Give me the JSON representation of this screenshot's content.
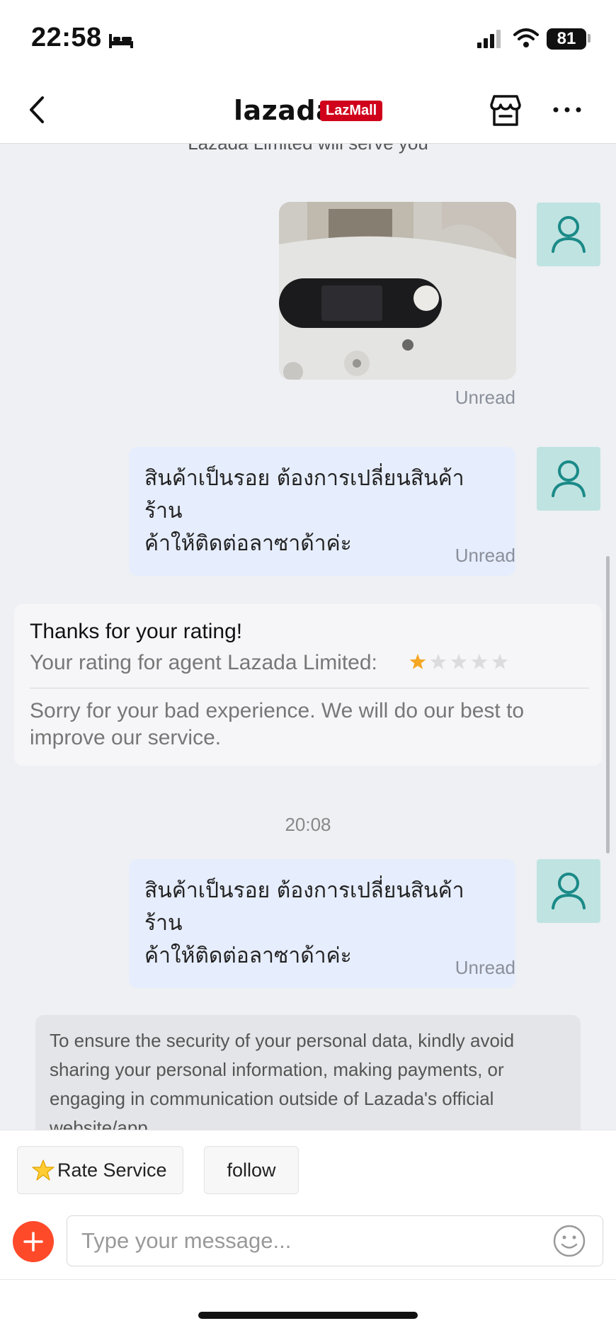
{
  "status_bar": {
    "time": "22:58",
    "battery": "81"
  },
  "header": {
    "brand": "lazada",
    "badge": "LazMall"
  },
  "chat": {
    "cut_note": "Lazada Limited will serve you",
    "messages": [
      {
        "type": "image",
        "status": "Unread"
      },
      {
        "type": "text",
        "text": "สินค้าเป็นรอย ต้องการเปลี่ยนสินค้า ร้านค้าให้ติดต่อลาซาด้าค่ะ",
        "line1": "สินค้าเป็นรอย ต้องการเปลี่ยนสินค้า ร้าน",
        "line2": "ค้าให้ติดต่อลาซาด้าค่ะ",
        "status": "Unread"
      },
      {
        "type": "text",
        "text": "สินค้าเป็นรอย ต้องการเปลี่ยนสินค้า ร้านค้าให้ติดต่อลาซาด้าค่ะ",
        "line1": "สินค้าเป็นรอย ต้องการเปลี่ยนสินค้า ร้าน",
        "line2": "ค้าให้ติดต่อลาซาด้าค่ะ",
        "status": "Unread"
      }
    ],
    "rating_card": {
      "title": "Thanks for your rating!",
      "agent_line": "Your rating for agent Lazada Limited:",
      "rating": 1,
      "max_rating": 5,
      "message": "Sorry for your bad experience. We will do our best to improve our service."
    },
    "time_separator": "20:08",
    "security_notice": "To ensure the security of your personal data,  kindly avoid sharing your personal information, making payments, or engaging in communication outside of Lazada's official website/app."
  },
  "quick_actions": {
    "rate_label": "Rate Service",
    "follow_label": "follow"
  },
  "composer": {
    "placeholder": "Type your message..."
  },
  "colors": {
    "accent": "#ff4a2a",
    "lazmall": "#d0021b",
    "outgoing_bubble": "#e6edfc",
    "avatar_bg": "#bfe3e1",
    "star": "#f5a623"
  }
}
